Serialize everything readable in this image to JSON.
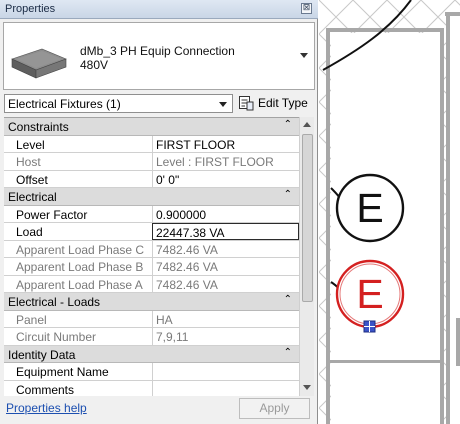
{
  "palette": {
    "title": "Properties",
    "close_glyph": "⊠",
    "type_selector": {
      "family_name": "dMb_3 PH Equip Connection",
      "type_name": "480V",
      "thumbnail_icon": "equipment-box-icon"
    },
    "filter": {
      "value": "Electrical Fixtures (1)",
      "edit_type_label": "Edit Type",
      "edit_type_icon": "edit-type-icon"
    },
    "groups": [
      {
        "name": "Constraints",
        "caret": "⌃",
        "rows": [
          {
            "name": "Level",
            "value": "FIRST FLOOR",
            "readonly": false
          },
          {
            "name": "Host",
            "value": "Level : FIRST FLOOR",
            "readonly": true
          },
          {
            "name": "Offset",
            "value": "0'  0\"",
            "readonly": false
          }
        ]
      },
      {
        "name": "Electrical",
        "caret": "⌃",
        "rows": [
          {
            "name": "Power Factor",
            "value": "0.900000",
            "readonly": false
          },
          {
            "name": "Load",
            "value": "22447.38 VA",
            "readonly": false
          },
          {
            "name": "Apparent Load Phase C",
            "value": "7482.46 VA",
            "readonly": true
          },
          {
            "name": "Apparent Load Phase B",
            "value": "7482.46 VA",
            "readonly": true
          },
          {
            "name": "Apparent Load Phase A",
            "value": "7482.46 VA",
            "readonly": true
          }
        ]
      },
      {
        "name": "Electrical - Loads",
        "caret": "⌃",
        "rows": [
          {
            "name": "Panel",
            "value": "HA",
            "readonly": true
          },
          {
            "name": "Circuit Number",
            "value": "7,9,11",
            "readonly": true
          }
        ]
      },
      {
        "name": "Identity Data",
        "caret": "⌃",
        "rows": [
          {
            "name": "Equipment Name",
            "value": "",
            "readonly": false
          },
          {
            "name": "Comments",
            "value": "",
            "readonly": false
          }
        ]
      }
    ],
    "footer": {
      "help_link": "Properties help",
      "apply_label": "Apply"
    }
  },
  "canvas": {
    "symbol_black": "E",
    "symbol_red": "E",
    "colors": {
      "selected": "#d42020",
      "wall": "#a8a8a8",
      "hatch": "#c8c8c8",
      "grip": "#3b53c8"
    }
  }
}
